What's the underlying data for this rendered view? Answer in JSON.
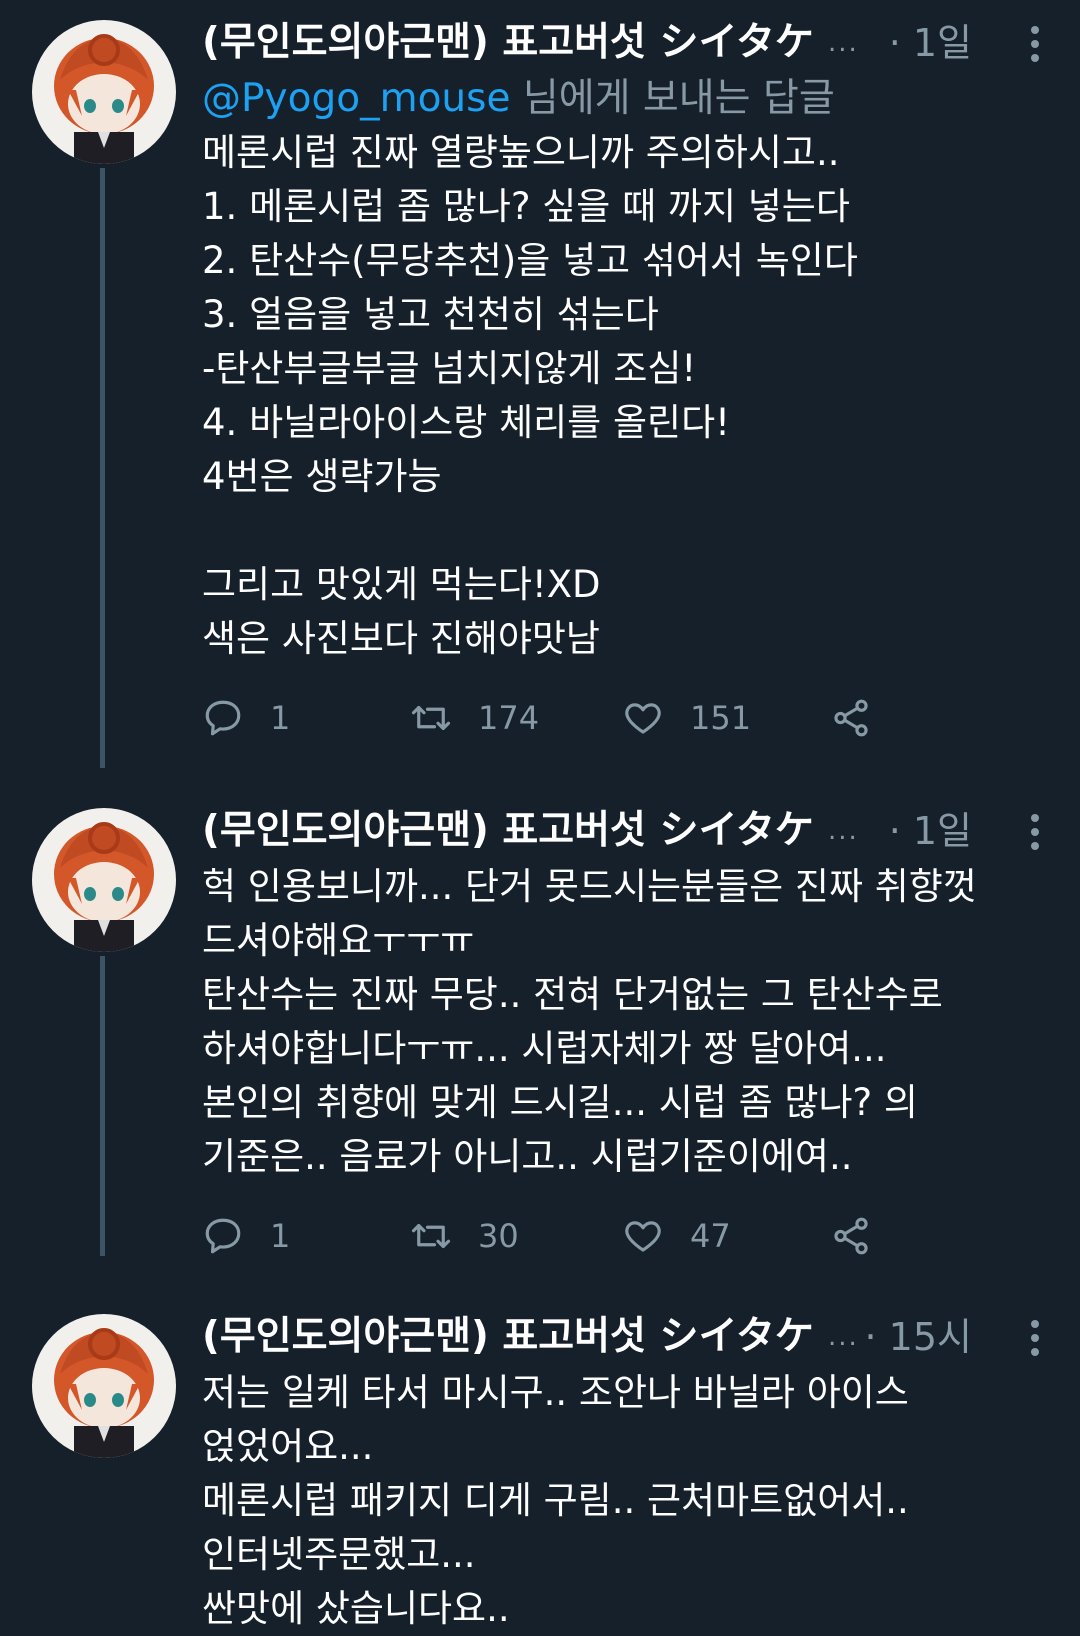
{
  "tweets": [
    {
      "author": "(무인도의야근맨) 표고버섯 シイタケ",
      "author_ellipsis": "...",
      "time": "· 1일",
      "reply_prefix": "@Pyogo_mouse",
      "reply_suffix": " 님에게 보내는 답글",
      "lines": [
        "메론시럽 진짜 열량높으니까 주의하시고..",
        "1. 메론시럽 좀 많나? 싶을 때 까지 넣는다",
        "2. 탄산수(무당추천)을 넣고 섞어서 녹인다",
        "3. 얼음을 넣고 천천히 섞는다",
        "-탄산부글부글 넘치지않게 조심!",
        "4. 바닐라아이스랑 체리를 올린다!",
        "4번은 생략가능",
        "",
        "그리고 맛있게 먹는다!XD",
        "색은 사진보다 진해야맛남"
      ],
      "replies": "1",
      "retweets": "174",
      "likes": "151"
    },
    {
      "author": "(무인도의야근맨) 표고버섯 シイタケ",
      "author_ellipsis": "...",
      "time": "· 1일",
      "lines": [
        "헉 인용보니까... 단거 못드시는분들은 진짜 취향껏",
        "드셔야해요ㅜㅜㅠ",
        "탄산수는 진짜 무당.. 전혀 단거없는 그 탄산수로",
        "하셔야합니다ㅜㅠ... 시럽자체가 짱 달아여...",
        "본인의 취향에 맞게 드시길... 시럽 좀 많나? 의",
        "기준은.. 음료가 아니고.. 시럽기준이에여.."
      ],
      "replies": "1",
      "retweets": "30",
      "likes": "47"
    },
    {
      "author": "(무인도의야근맨) 표고버섯 シイタケ",
      "author_ellipsis": "...",
      "time": "· 15시",
      "lines": [
        "저는 일케 타서 마시구.. 조안나 바닐라 아이스",
        "얹었어요...",
        "메론시럽 패키지 디게 구림.. 근처마트없어서..",
        "인터넷주문했고...",
        "싼맛에 샀습니다요.."
      ]
    }
  ],
  "colors": {
    "background": "#15202b",
    "text": "#ffffff",
    "muted": "#8899a6",
    "link": "#1da1f2",
    "thread_line": "#3d5466"
  },
  "icons": [
    "comment-icon",
    "retweet-icon",
    "heart-icon",
    "share-icon",
    "more-vertical-icon"
  ]
}
